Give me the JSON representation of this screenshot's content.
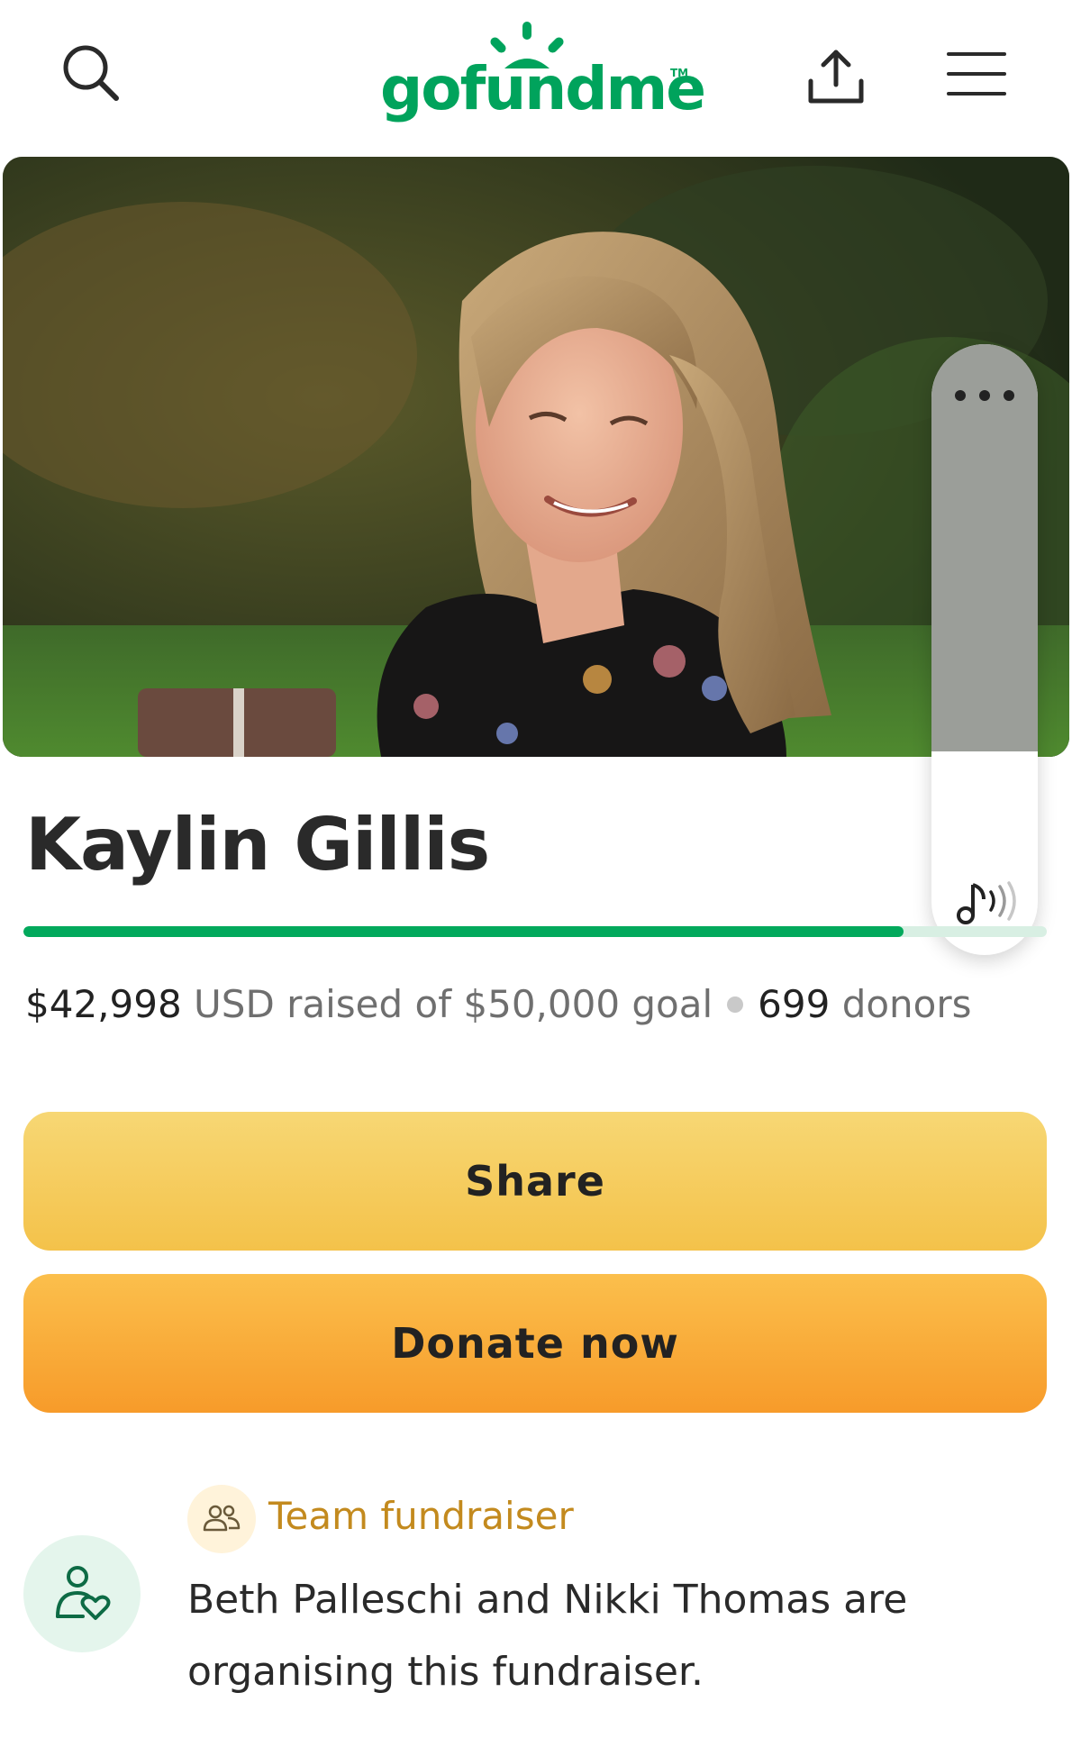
{
  "header": {
    "logo_text": "gofundme",
    "logo_tm": "TM",
    "icons": {
      "search": "search-icon",
      "share": "share-upload-icon",
      "menu": "hamburger-menu-icon"
    },
    "brand_color": "#00a35c"
  },
  "hero": {
    "image_description_icon": "fundraiser-photo"
  },
  "audio_widget": {
    "more_icon": "more-dots-icon",
    "audio_icon": "audio-note-icon",
    "level": 0.667
  },
  "campaign": {
    "title": "Kaylin Gillis",
    "progress_fraction": 0.86,
    "raised_amount": "$42,998",
    "raised_suffix": " USD raised of $50,000 goal",
    "donor_count": "699",
    "donor_suffix": " donors",
    "progress_color": "#02a95c"
  },
  "actions": {
    "share_label": "Share",
    "donate_label": "Donate now"
  },
  "organizer": {
    "badge_icon": "team-people-icon",
    "badge_label": "Team fundraiser",
    "avatar_icon": "person-heart-icon",
    "text": "Beth Palleschi and Nikki Thomas are organising this fundraiser."
  }
}
